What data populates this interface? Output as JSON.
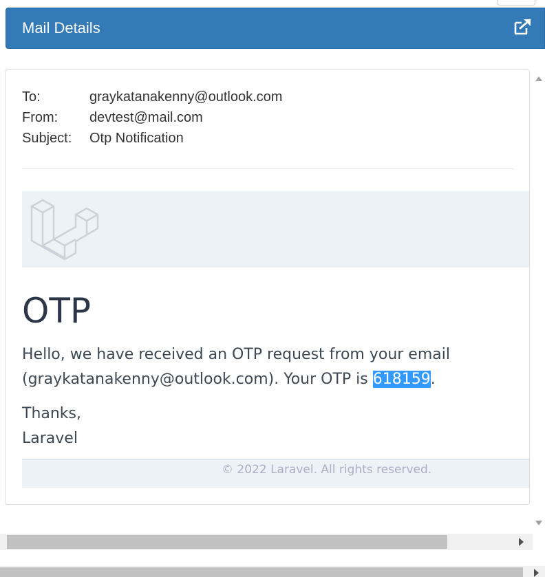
{
  "header": {
    "title": "Mail Details",
    "icon": "external-link-icon",
    "color": "#337ab7"
  },
  "mail": {
    "fields": [
      {
        "label": "To:",
        "value": "graykatanakenny@outlook.com"
      },
      {
        "label": "From:",
        "value": "devtest@mail.com"
      },
      {
        "label": "Subject:",
        "value": "Otp Notification"
      }
    ]
  },
  "email_body": {
    "logo": "laravel-logo-icon",
    "heading": "OTP",
    "paragraph_before": "Hello, we have received an OTP request from your email (graykatanakenny@outlook.com). Your OTP is ",
    "otp_code": "618159",
    "paragraph_after": ".",
    "thanks": "Thanks,",
    "signature": "Laravel",
    "footer": "© 2022 Laravel. All rights reserved.",
    "otp_highlight_color": "#3399ff"
  }
}
